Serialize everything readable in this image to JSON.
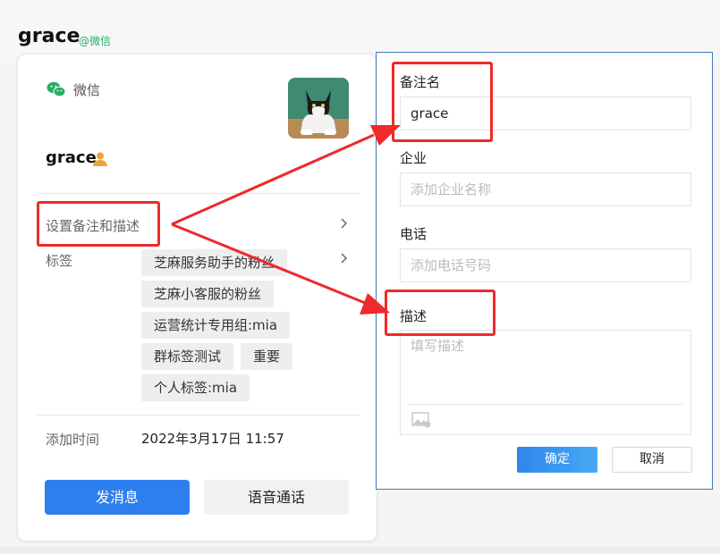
{
  "header": {
    "title": "grace",
    "source": "@微信"
  },
  "card": {
    "source_label": "微信",
    "name": "grace",
    "remark_row_label": "设置备注和描述",
    "tags_label": "标签",
    "tags": [
      "芝麻服务助手的粉丝",
      "芝麻小客服的粉丝",
      "运营统计专用组:mia",
      "群标签测试",
      "重要",
      "个人标签:mia"
    ],
    "added_label": "添加时间",
    "added_value": "2022年3月17日 11:57",
    "send_button": "发消息",
    "voice_button": "语音通话"
  },
  "dialog": {
    "remark_label": "备注名",
    "remark_value": "grace",
    "company_label": "企业",
    "company_placeholder": "添加企业名称",
    "phone_label": "电话",
    "phone_placeholder": "添加电话号码",
    "desc_label": "描述",
    "desc_placeholder": "填写描述",
    "confirm_button": "确定",
    "cancel_button": "取消"
  },
  "colors": {
    "accent": "#2d7ff0",
    "wechat_green": "#2aae67",
    "annotation_red": "#ee2a2a",
    "dialog_border": "#3f76bd"
  }
}
